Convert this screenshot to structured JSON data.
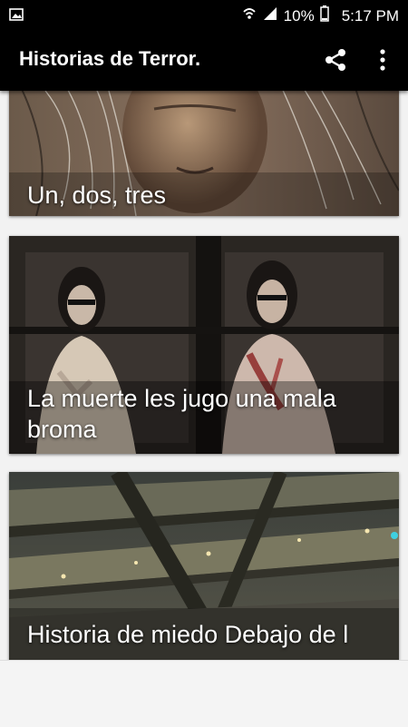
{
  "status_bar": {
    "battery_percent": "10%",
    "time": "5:17 PM",
    "icons": [
      "image-icon",
      "wifi-icon",
      "signal-icon",
      "battery-icon"
    ]
  },
  "app_bar": {
    "title": "Historias de Terror.",
    "icons": [
      "share-icon",
      "more-vert-icon"
    ]
  },
  "stories": [
    {
      "title": "Un, dos, tres"
    },
    {
      "title": "La muerte les jugo una mala broma"
    },
    {
      "title": "Historia de miedo Debajo de l"
    }
  ],
  "colors": {
    "bar_background": "#000000",
    "page_background": "#f2f2f2",
    "text_on_bar": "#ffffff"
  }
}
